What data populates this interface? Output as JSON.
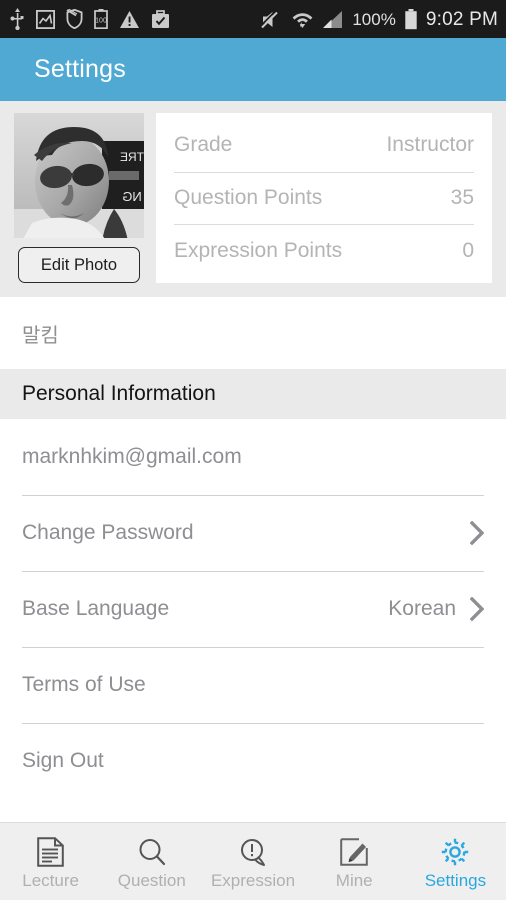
{
  "status_bar": {
    "time": "9:02 PM",
    "battery_percent": "100%",
    "icons": [
      "usb-icon",
      "image-icon",
      "shield-off-icon",
      "battery-saver-icon",
      "warning-icon",
      "work-briefcase-icon",
      "volume-mute-icon",
      "wifi-icon",
      "cellular-signal-icon",
      "battery-full-icon"
    ]
  },
  "app_bar": {
    "title": "Settings",
    "background_color": "#4fa9d3"
  },
  "profile": {
    "edit_photo_label": "Edit Photo",
    "avatar_alt": "user-profile-photo",
    "stats": [
      {
        "label": "Grade",
        "value": "Instructor"
      },
      {
        "label": "Question Points",
        "value": "35"
      },
      {
        "label": "Expression Points",
        "value": "0"
      }
    ],
    "display_name": "말킴"
  },
  "section": {
    "personal_information_title": "Personal Information"
  },
  "settings_rows": [
    {
      "label": "marknhkim@gmail.com",
      "value": "",
      "chevron": false,
      "divider": false
    },
    {
      "label": "Change Password",
      "value": "",
      "chevron": true,
      "divider": true
    },
    {
      "label": "Base Language",
      "value": "Korean",
      "chevron": true,
      "divider": true
    },
    {
      "label": "Terms of Use",
      "value": "",
      "chevron": false,
      "divider": true
    },
    {
      "label": "Sign Out",
      "value": "",
      "chevron": false,
      "divider": true
    }
  ],
  "bottom_nav": {
    "active_color": "#29a8e0",
    "items": [
      {
        "label": "Lecture",
        "icon": "document-icon",
        "active": false
      },
      {
        "label": "Question",
        "icon": "search-icon",
        "active": false
      },
      {
        "label": "Expression",
        "icon": "speech-bubble-exclamation-icon",
        "active": false
      },
      {
        "label": "Mine",
        "icon": "edit-pencil-icon",
        "active": false
      },
      {
        "label": "Settings",
        "icon": "gear-icon",
        "active": true
      }
    ]
  }
}
